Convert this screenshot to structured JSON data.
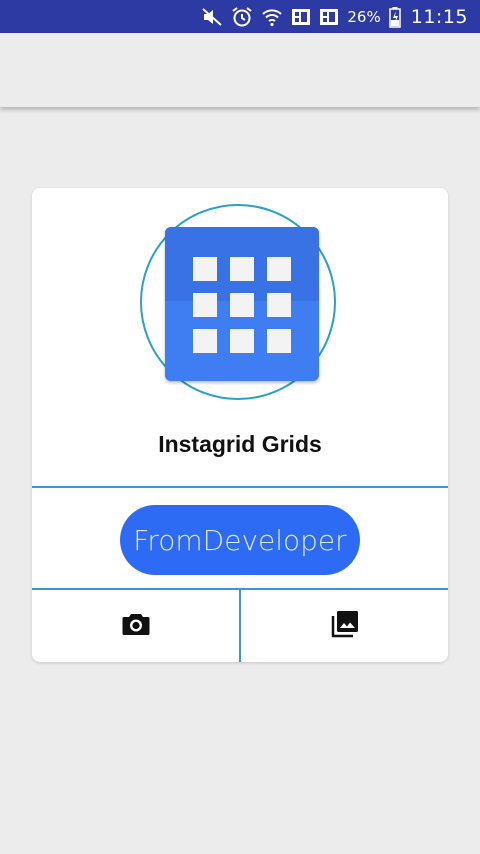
{
  "status_bar": {
    "battery_percent": "26%",
    "time": "11:15",
    "icons": [
      "mute-icon",
      "alarm-icon",
      "wifi-icon",
      "sim1-signal-icon",
      "sim2-signal-icon",
      "battery-charging-icon"
    ]
  },
  "card": {
    "app_icon": "grid-app-icon",
    "title": "Instagrid Grids",
    "developer_button_label": "FromDeveloper",
    "actions": {
      "camera_icon": "camera-icon",
      "gallery_icon": "photo-library-icon"
    }
  },
  "colors": {
    "status_bar": "#2d3aa4",
    "accent_blue": "#2e6bf4",
    "divider": "#3a96d6",
    "ring": "#2aa0c8"
  }
}
